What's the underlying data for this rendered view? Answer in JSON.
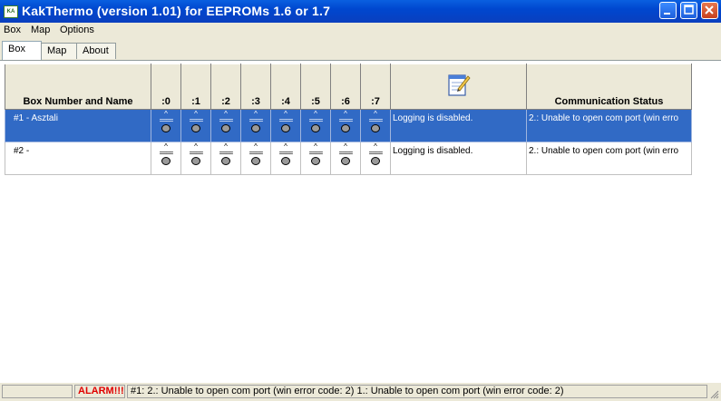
{
  "window": {
    "title": "KakThermo (version 1.01) for EEPROMs 1.6 or 1.7",
    "app_icon_text": "KA"
  },
  "menu": [
    "Box",
    "Map",
    "Options"
  ],
  "tabs": [
    "Box",
    "Map",
    "About"
  ],
  "table": {
    "headers": {
      "name": "Box Number and Name",
      "bits": [
        ":0",
        ":1",
        ":2",
        ":3",
        ":4",
        ":5",
        ":6",
        ":7"
      ],
      "status": "Communication Status"
    },
    "bit_caret": "^",
    "bit_lines": "====",
    "rows": [
      {
        "name": "#1 - Asztali",
        "log": "Logging is disabled.",
        "status": "2.: Unable to open com port (win erro",
        "selected": true
      },
      {
        "name": "#2 -",
        "log": "Logging is disabled.",
        "status": "2.: Unable to open com port (win erro",
        "selected": false
      }
    ]
  },
  "statusbar": {
    "alarm": "ALARM!!!",
    "message": "#1: 2.: Unable to open com port (win error code: 2) 1.: Unable to open com port (win error code: 2)"
  },
  "colors": {
    "selection": "#316AC5",
    "alarm": "#E00000",
    "titlebar": "#0047CF"
  }
}
